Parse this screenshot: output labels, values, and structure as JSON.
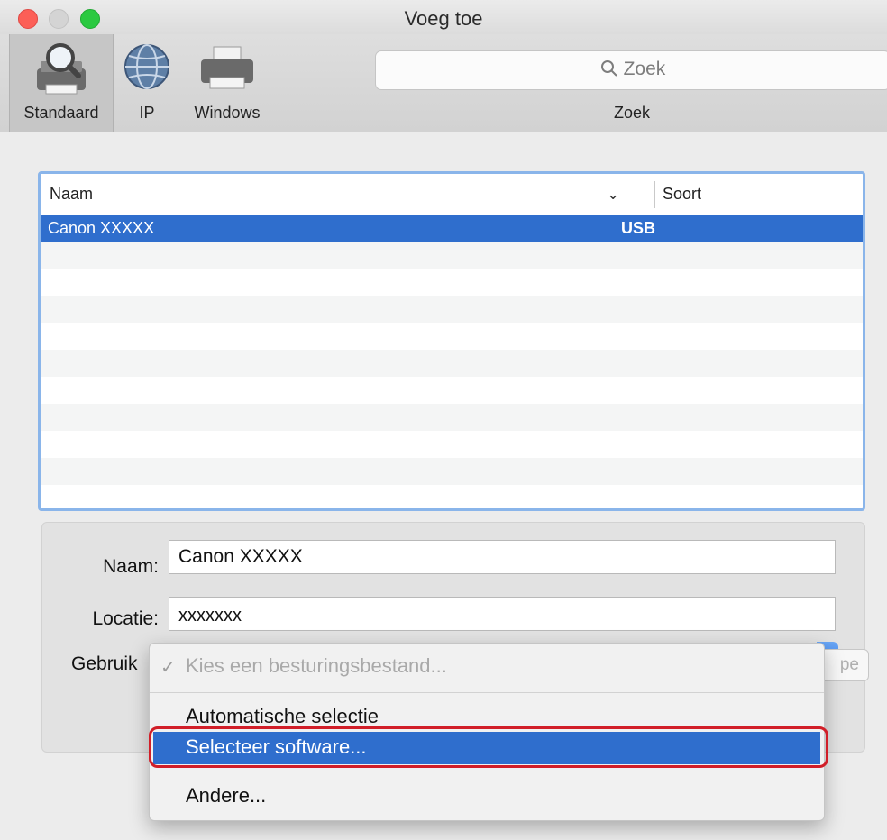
{
  "window": {
    "title": "Voeg toe"
  },
  "toolbar": {
    "tabs": [
      {
        "label": "Standaard",
        "icon": "printer-magnifier-icon",
        "selected": true
      },
      {
        "label": "IP",
        "icon": "globe-icon",
        "selected": false
      },
      {
        "label": "Windows",
        "icon": "printer-icon",
        "selected": false
      }
    ],
    "search": {
      "placeholder": "Zoek",
      "label": "Zoek"
    }
  },
  "list": {
    "columns": {
      "name": "Naam",
      "type": "Soort"
    },
    "rows": [
      {
        "name": "Canon XXXXX",
        "type": "USB",
        "selected": true
      }
    ]
  },
  "form": {
    "name_label": "Naam:",
    "name_value": "Canon XXXXX",
    "location_label": "Locatie:",
    "location_value": "xxxxxxx",
    "use_label": "Gebruik"
  },
  "driver_menu": {
    "current": "Kies een besturingsbestand...",
    "items": [
      "Automatische selectie",
      "Selecteer software...",
      "Andere..."
    ],
    "highlighted": "Selecteer software..."
  },
  "footer": {
    "add_button_partial": "pe"
  },
  "colors": {
    "selection": "#2f6ecd",
    "annotation": "#d11e28",
    "focus_ring": "#8ab5ea"
  }
}
